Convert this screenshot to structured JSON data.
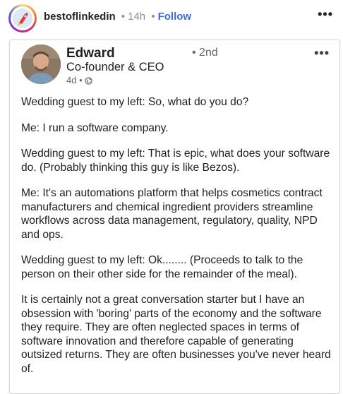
{
  "instagram": {
    "username": "bestoflinkedin",
    "separator": "•",
    "time": "14h",
    "follow_label": "Follow",
    "more_icon": "ellipsis-icon"
  },
  "post": {
    "author": "Edward",
    "degree": "• 2nd",
    "title": "Co-founder & CEO",
    "time": "4d •",
    "visibility_icon": "globe-icon",
    "more_icon": "ellipsis-icon",
    "paragraphs": [
      "Wedding guest to my left: So, what do you do?",
      "Me: I run a software company.",
      "Wedding guest to my left: That is epic, what does your software do. (Probably thinking this guy is like Bezos).",
      "Me: It's an automations platform that helps cosmetics contract manufacturers and chemical ingredient providers streamline workflows across data management, regulatory, quality, NPD and ops.",
      "Wedding guest to my left: Ok........ (Proceeds to talk to the person on their other side for the remainder of the meal).",
      "It is certainly not a great conversation starter but I have an obsession with 'boring' parts of the economy and the software they require. They are often neglected spaces in terms of software innovation and therefore capable of generating outsized returns. They are often businesses you've never heard of."
    ]
  },
  "colors": {
    "follow_blue": "#3b6ed8",
    "card_border": "#d8d8d8",
    "text_dark": "#1f1f1f",
    "text_muted": "#8e8e8e"
  }
}
